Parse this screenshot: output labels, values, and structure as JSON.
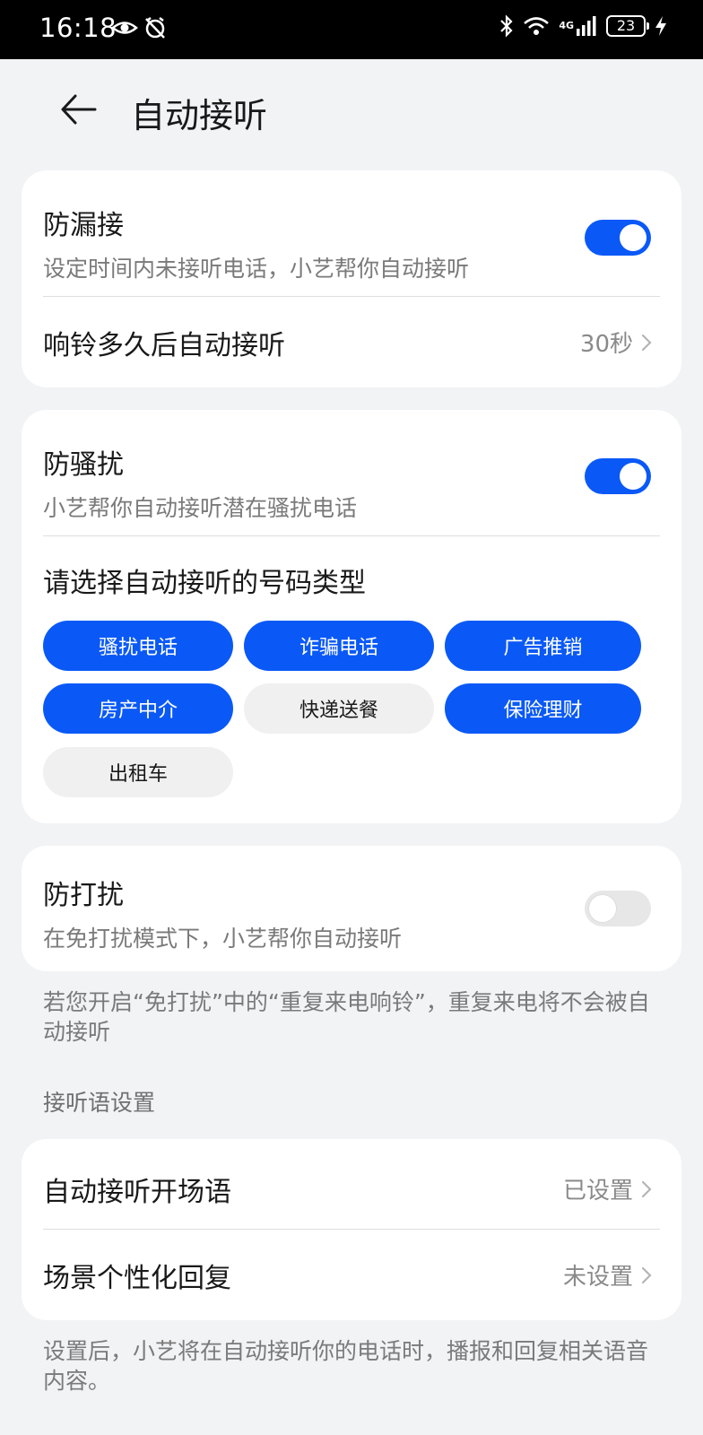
{
  "status_bar": {
    "time": "16:18",
    "network": "4G",
    "battery": "23"
  },
  "header": {
    "title": "自动接听",
    "back_icon": "arrow-left-icon"
  },
  "missed_call": {
    "title": "防漏接",
    "subtitle": "设定时间内未接听电话，小艺帮你自动接听",
    "toggle_on": true,
    "delay_label": "响铃多久后自动接听",
    "delay_value": "30秒"
  },
  "harassment": {
    "title": "防骚扰",
    "subtitle": "小艺帮你自动接听潜在骚扰电话",
    "toggle_on": true,
    "types_label": "请选择自动接听的号码类型",
    "chips": [
      {
        "label": "骚扰电话",
        "selected": true
      },
      {
        "label": "诈骗电话",
        "selected": true
      },
      {
        "label": "广告推销",
        "selected": true
      },
      {
        "label": "房产中介",
        "selected": true
      },
      {
        "label": "快递送餐",
        "selected": false
      },
      {
        "label": "保险理财",
        "selected": true
      },
      {
        "label": "出租车",
        "selected": false
      }
    ]
  },
  "dnd": {
    "title": "防打扰",
    "subtitle": "在免打扰模式下，小艺帮你自动接听",
    "toggle_on": false,
    "note": "若您开启“免打扰”中的“重复来电响铃”，重复来电将不会被自动接听"
  },
  "greeting": {
    "section_label": "接听语设置",
    "opening_label": "自动接听开场语",
    "opening_value": "已设置",
    "reply_label": "场景个性化回复",
    "reply_value": "未设置",
    "note": "设置后，小艺将在自动接听你的电话时，播报和回复相关语音内容。"
  },
  "colors": {
    "accent": "#0a59f7",
    "background": "#f1f3f5"
  }
}
